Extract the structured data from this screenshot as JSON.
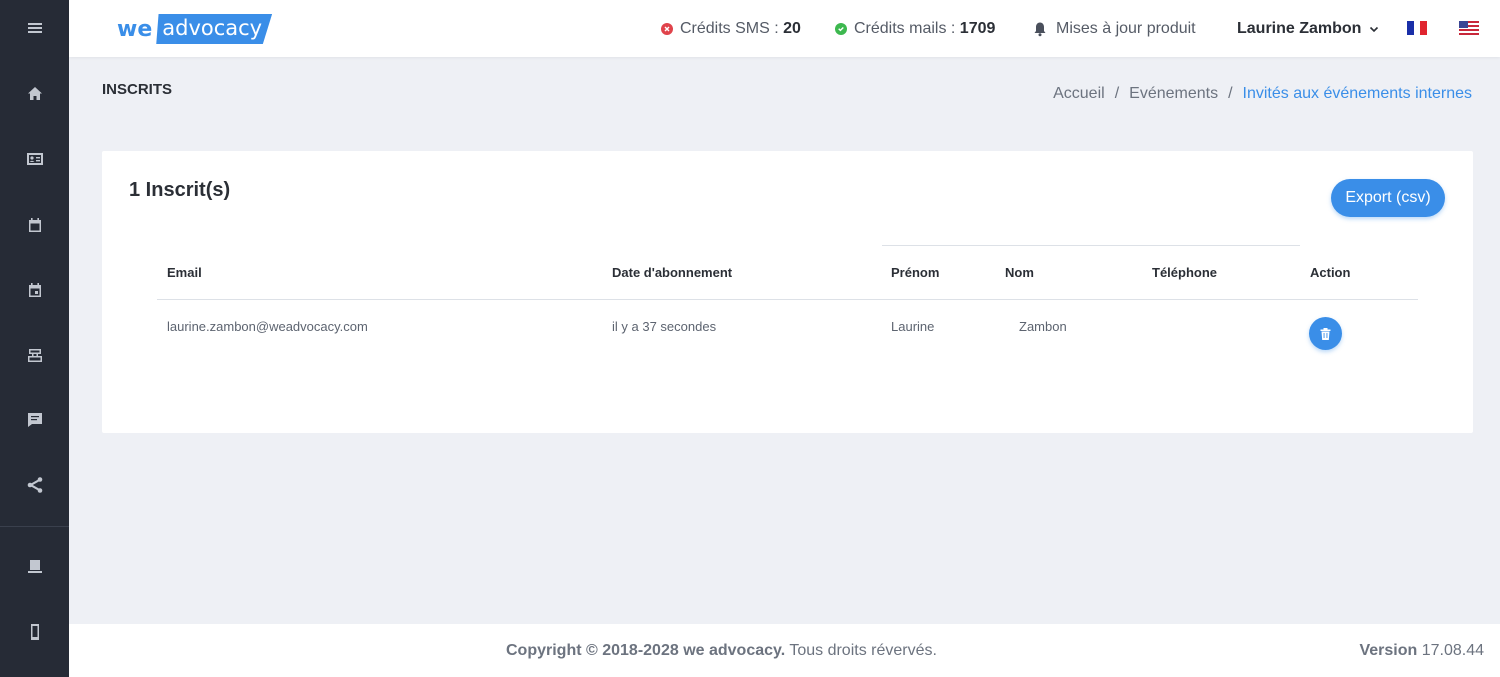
{
  "sidebar": {
    "items": [
      {
        "icon": "menu-icon"
      },
      {
        "icon": "home-icon"
      },
      {
        "icon": "contact-card-icon"
      },
      {
        "icon": "calendar-icon"
      },
      {
        "icon": "calendar-event-icon"
      },
      {
        "icon": "inbox-icon"
      },
      {
        "icon": "chat-icon"
      },
      {
        "icon": "share-icon"
      },
      {
        "icon": "desktop-icon"
      },
      {
        "icon": "mobile-icon"
      }
    ]
  },
  "header": {
    "logo_we": "we",
    "logo_advocacy": "advocacy",
    "sms_label": "Crédits SMS : ",
    "sms_value": "20",
    "mail_label": "Crédits mails : ",
    "mail_value": "1709",
    "updates_label": "Mises à jour produit",
    "user_name": "Laurine Zambon"
  },
  "page": {
    "title": "INSCRITS",
    "breadcrumb": [
      "Accueil",
      "Evénements",
      "Invités aux événements internes"
    ]
  },
  "card": {
    "title": "1 Inscrit(s)",
    "export_label": "Export (csv)",
    "columns": [
      "Email",
      "Date d'abonnement",
      "Prénom",
      "Nom",
      "Téléphone",
      "Action"
    ],
    "rows": [
      {
        "email": "laurine.zambon@weadvocacy.com",
        "date": "il y a 37 secondes",
        "prenom": "Laurine",
        "nom": "Zambon",
        "telephone": ""
      }
    ]
  },
  "footer": {
    "copyright_bold": "Copyright © 2018-2028 we advocacy.",
    "copyright_rest": " Tous droits révervés.",
    "version_label": "Version",
    "version_value": " 17.08.44"
  },
  "colors": {
    "accent": "#3a8ee8",
    "sidebar": "#262b36",
    "sms_status": "#e0434b",
    "mail_status": "#3db84f"
  }
}
